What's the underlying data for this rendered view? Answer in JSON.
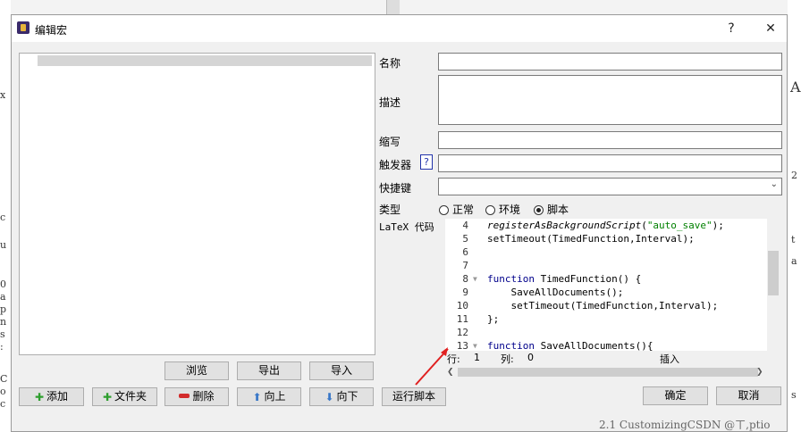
{
  "dialog": {
    "title": "编辑宏",
    "help_label": "?",
    "close_label": "✕"
  },
  "left_buttons": {
    "browse": "浏览",
    "export": "导出",
    "import": "导入",
    "add": "添加",
    "folder": "文件夹",
    "delete": "删除",
    "up": "向上",
    "down": "向下",
    "run_script": "运行脚本"
  },
  "form": {
    "name_label": "名称",
    "desc_label": "描述",
    "abbrev_label": "缩写",
    "trigger_label": "触发器",
    "trigger_help": "?",
    "shortcut_label": "快捷键",
    "type_label": "类型",
    "code_label": "LaTeX 代码",
    "type_options": [
      "正常",
      "环境",
      "脚本"
    ],
    "type_selected": "脚本"
  },
  "editor": {
    "lines": [
      {
        "n": "4",
        "fold": false,
        "html": "<span class='fn'>registerAsBackgroundScript</span>(<span class='str'>\"auto_save\"</span>);"
      },
      {
        "n": "5",
        "fold": false,
        "html": "setTimeout(TimedFunction,Interval);"
      },
      {
        "n": "6",
        "fold": false,
        "html": ""
      },
      {
        "n": "7",
        "fold": false,
        "html": ""
      },
      {
        "n": "8",
        "fold": true,
        "html": "<span class='kw'>function</span> TimedFunction() {"
      },
      {
        "n": "9",
        "fold": false,
        "html": "    SaveAllDocuments();"
      },
      {
        "n": "10",
        "fold": false,
        "html": "    setTimeout(TimedFunction,Interval);"
      },
      {
        "n": "11",
        "fold": false,
        "html": "};"
      },
      {
        "n": "12",
        "fold": false,
        "html": ""
      },
      {
        "n": "13",
        "fold": true,
        "html": "<span class='kw'>function</span> SaveAllDocuments(){"
      }
    ],
    "status_row_label": "行:",
    "status_row": "1",
    "status_col_label": "列:",
    "status_col": "0",
    "status_mode": "插入"
  },
  "footer": {
    "ok": "确定",
    "cancel": "取消"
  },
  "background": {
    "watermark": "2.1  CustomizingCSDN @ㄒ,ptio"
  },
  "colors": {
    "add_icon": "#2e9e2e",
    "delete_icon": "#d22b2b",
    "arrow_icon": "#3a78c8",
    "annotation_arrow": "#e02020"
  }
}
